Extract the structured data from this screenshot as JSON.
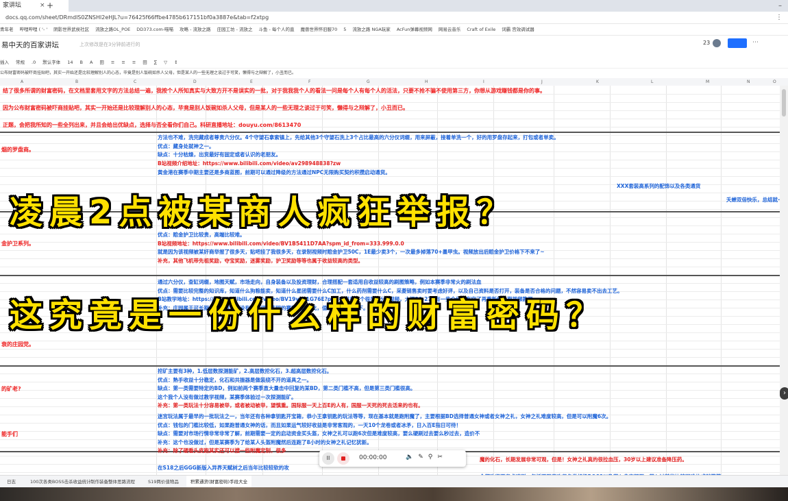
{
  "browser": {
    "tab_title": "家讲坛",
    "tab_close": "×",
    "tab_new": "+",
    "url": "docs.qq.com/sheet/DRmdlS0ZNSHl2eHJL?u=76425f66ffbe4785b617151bf0a3887e&tab=f2xtpg",
    "bookmarks": [
      "青年老",
      "哔哩哔哩 ( '- '",
      "阴影世界武侯社区",
      "流放之路OL_POE",
      "DD373.com-喵喵",
      "攻略 - 流放之路",
      "庄园工坊 - 流放之",
      "斗鱼 - 每个人的直",
      "魔兽世界怀旧服70",
      "5",
      "流放之路 NGA玩家",
      "AcFun弹幕视频网",
      "网易云音乐",
      "Craft of Exile",
      "词霸 宫效调试器"
    ]
  },
  "doc": {
    "title": "易中天的百家讲坛",
    "star": "☆",
    "status": "上次修改是在3分钟前进行的",
    "collaborators": "23",
    "more": "⋯"
  },
  "toolbar": {
    "items": [
      "插入",
      "常规",
      ".0",
      "默认字体",
      "14",
      "B",
      "A",
      "田",
      "≡",
      "≡",
      "≡",
      "田",
      "∑",
      "▽",
      "↕"
    ]
  },
  "formula_bar": "公布财富密码被吓商挂贴吧，其实一开始还是比较理解别人的心态，毕竟是别人饭碗如杀人父母，但是某人的一些无理之谈过于可笑，懒得与之辩解了，小丑而已。",
  "columns": [
    "A",
    "B",
    "C",
    "D",
    "E",
    "F",
    "G",
    "H",
    "I",
    "J",
    "K",
    "L",
    "M",
    "N",
    "O"
  ],
  "sheet": {
    "red_rows": [
      "结了很多所谓的财富密码，在文档里套用文字的方法总结一遍，我按个人所知真实与大致方开不是误实的一批，对于我我我个人的看法一问是每个人有每个人的活法，只要不抢不骗不使用第三方，你想从游戏赚钱都是你的事。",
      "因为公布财富密码被吓商挂贴吧，其实一开始还是比较理解别人的心态，毕竟是别人饭碗如杀人父母，但是某人的一些无理之谈过于可笑，懒得与之辩解了，小丑而已。",
      "正题，会把我所知的一些全列出来，并且会给出优缺点，选择与否全看你们自己。科研直播地址：douyu.com/8613470"
    ],
    "left_labels": [
      "烟的罗盘商。",
      "金护卫系列。",
      "衰的庄园党。",
      "的矿老?",
      "能手们"
    ],
    "section_1": [
      "方法也不难，洗完藏成者尊贵六分仪。4个守望石拿索镇上，先给其他3个守望石洗上3个占比最高的六分仪词缀，用来屏蔽，接着单洗一个，好的用罗盘存起来，打包或者单卖。",
      "优点：藏身处就神之一。",
      "缺点：十分枯燥，出货最好有固定或者认识的老朋友。",
      "B站视频介绍地址：https://www.bilibili.com/video/av298948838?zw"
    ],
    "section_2": [
      "黄金港在赛季中期主要还是多商蓝图，前期可以通过降级的方法通过NPC无限购买契约积攒启动通货。",
      "XXX套装高系列的配饰以及各类通货",
      "夭蝉双倍快乐，总结就一句话尽量堆积物品数量。"
    ],
    "section_3": [
      "优点：赔金护卫比较贵，高端比较难。",
      "B站视频地址：https://www.bilibili.com/video/BV1B5411D7AA?spm_id_from=333.999.0.0",
      "就是因为该视频被某奸商举报了很多天，贴吧挂了我很多天，在录制视频时赔金护卫50C，1E最少卖3个，一次最多掉落70+墨甲虫。视频放出后赔金护卫价格下不来了~",
      "补充，其他飞机带先祖奖励，夺宝奖励，迷雾奖励，护卫奖励等等也属于收益较高的类型。"
    ],
    "section_4": [
      "通过六分仪，查缸词缀，地图天赋，市场走向，自身装备以及投资理财，合理搭配一套适用自收益较高的刷图策略，例如本赛季非常火的刷法血",
      "优点：需要比较完整的知识库，知道什么狗粮能卖，知道什么星团需要什么C加工，什么药剂需要什么C，采菱链售卖时要考虑好评，以及自己资料是否打开，装备是否合格的问题，不然容易卖不出去工艺。",
      "B站教学地址：https://www.bilibili.com/video/BV19v411G76E?p=20 只有一个很早的分P视频，大概20-27P有一些介绍，有空了再重新做一期视频教学。",
      "补充：庄园属于可长期发展类型，在没有查缸词缀庄园的赛季要是如此，值得深入学习一下。"
    ],
    "section_5": [
      "挖矿主要有3种，1.低层数探测能矿，2.高层数挖化石，3.超高层数挖化石。",
      "优点：熟手收益十分稳定，化石和共振器是做装绕不开的道具之一。",
      "缺点：第一类需要特定的BD，例如前两个赛季直大量击中回复的某BD，第二类门槛不高，但是第三类门槛很高。",
      "这个我个人没有做过教学视频，某赛季体验过一次探测能矿。",
      "补充：第一类玩法十分容易被举，或者被动被举，望慎重。国际服一天上百E的人有，国服一天死的死去活来的也有。"
    ],
    "section_6": [
      "迷宫玩法属于最早的一批玩法之一，当年还有各种拿钥匙开宝箱，恭小王拿钥匙的玩法等等，现在基本就是跑附魔了，主要根据BD选择普通女神或者女神之礼，女神之礼难度较高，但是可以附魔6次。",
      "优点：钱包的门槛比较低，如果跑普通女神的话，而且如果运气较好收益是非常客观的，一天10个龙卷或者冰矛，日入百E指日可待！",
      "缺点：需要对市场行情非常非常了解，前期需要一定的启动资金买头盔，女神之礼可以跑6次但是难度较高，要么硬刷过去要么秒过去，造价不",
      "补充：这个也没做过，但是某赛季为了给某人头盔附魔然后连跑了8小时的女神之礼记忆犹新。",
      "补充：除了硬看头皮跑其实还可以搜一些附魔定制，很多",
      "魔的化石，长期发展非常可观，但是！女神之礼真的很拉血压，30岁以上建议准备降压药。",
      "在S18之后GGG新版入异界天赋树之后当年比较较软的攻",
      "全都攻坚不考虑速刷，包括不限于攻坚各类超级BOSS以及带入拿守望石，带入过某些比较困难的成就等等。",
      "优点：S19新补充符的BOSS非常多，掉落的非常贵，前期拿出来BOSS基本打基础赚上去了日最要重跑带的视频，也后期期入"
    ]
  },
  "headline": {
    "line1": "凌晨2点被某商人疯狂举报？",
    "line2": "这究竟是一份什么样的财富密码？"
  },
  "player": {
    "pause": "II",
    "time": "00:00:00",
    "icons": [
      "🔈",
      "✎",
      "⚲",
      "✂"
    ]
  },
  "sheet_tabs": [
    "日志",
    "100次各类BOSS击杀收益统计",
    "制作装备整体思路流程",
    "S19两价值物品",
    "积累通货(财富密码)手段大全"
  ],
  "colors": {
    "red": "#e22222",
    "blue": "#1c62d8",
    "headline": "#ffe100",
    "share_button": "#1e6fff"
  }
}
